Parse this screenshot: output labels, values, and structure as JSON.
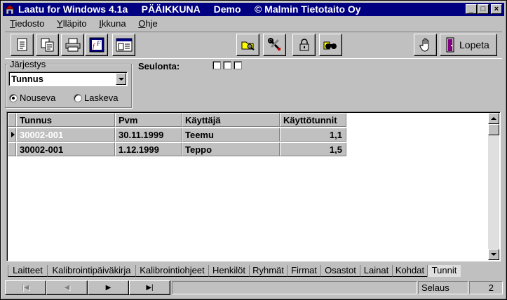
{
  "window": {
    "title": "Laatu for Windows 4.1a     PÄÄIKKUNA     Demo     © Malmin Tietotaito Oy",
    "controls": {
      "minimize": "_",
      "maximize": "□",
      "close": "×"
    }
  },
  "menu": {
    "items": [
      {
        "first": "T",
        "rest": "iedosto"
      },
      {
        "first": "Y",
        "rest": "lläpito"
      },
      {
        "first": "I",
        "rest": "kkuna"
      },
      {
        "first": "O",
        "rest": "hje"
      }
    ]
  },
  "toolbar": {
    "buttons": [
      "document-icon",
      "copy-icon",
      "printer-icon",
      "report-icon",
      "window-icon",
      "folder-search-icon",
      "tools-icon",
      "lock-icon",
      "binoculars-icon",
      "hand-icon"
    ],
    "exit_label": "Lopeta"
  },
  "sort": {
    "title": "Järjestys",
    "selected_field": "Tunnus",
    "options": [
      {
        "label": "Nouseva",
        "checked": true
      },
      {
        "label": "Laskeva",
        "checked": false
      }
    ]
  },
  "filter": {
    "label": "Seulonta:",
    "checkboxes": 3
  },
  "grid": {
    "columns": [
      "Tunnus",
      "Pvm",
      "Käyttäjä",
      "Käyttötunnit"
    ],
    "rows": [
      {
        "tunnus": "30002-001",
        "pvm": "30.11.1999",
        "kayttaja": "Teemu",
        "tunnit": "1,1",
        "current": true
      },
      {
        "tunnus": "30002-001",
        "pvm": "1.12.1999",
        "kayttaja": "Teppo",
        "tunnit": "1,5",
        "current": false
      }
    ]
  },
  "tabs": {
    "items": [
      "Laitteet",
      "Kalibrointipäiväkirja",
      "Kalibrointiohjeet",
      "Henkilöt",
      "Ryhmät",
      "Firmat",
      "Osastot",
      "Lainat",
      "Kohdat",
      "Tunnit"
    ],
    "active": "Tunnit"
  },
  "navigator": {
    "first": "|◀",
    "prev": "◀",
    "next": "▶",
    "last": "▶|"
  },
  "status": {
    "mode": "Selaus",
    "count": "2"
  }
}
